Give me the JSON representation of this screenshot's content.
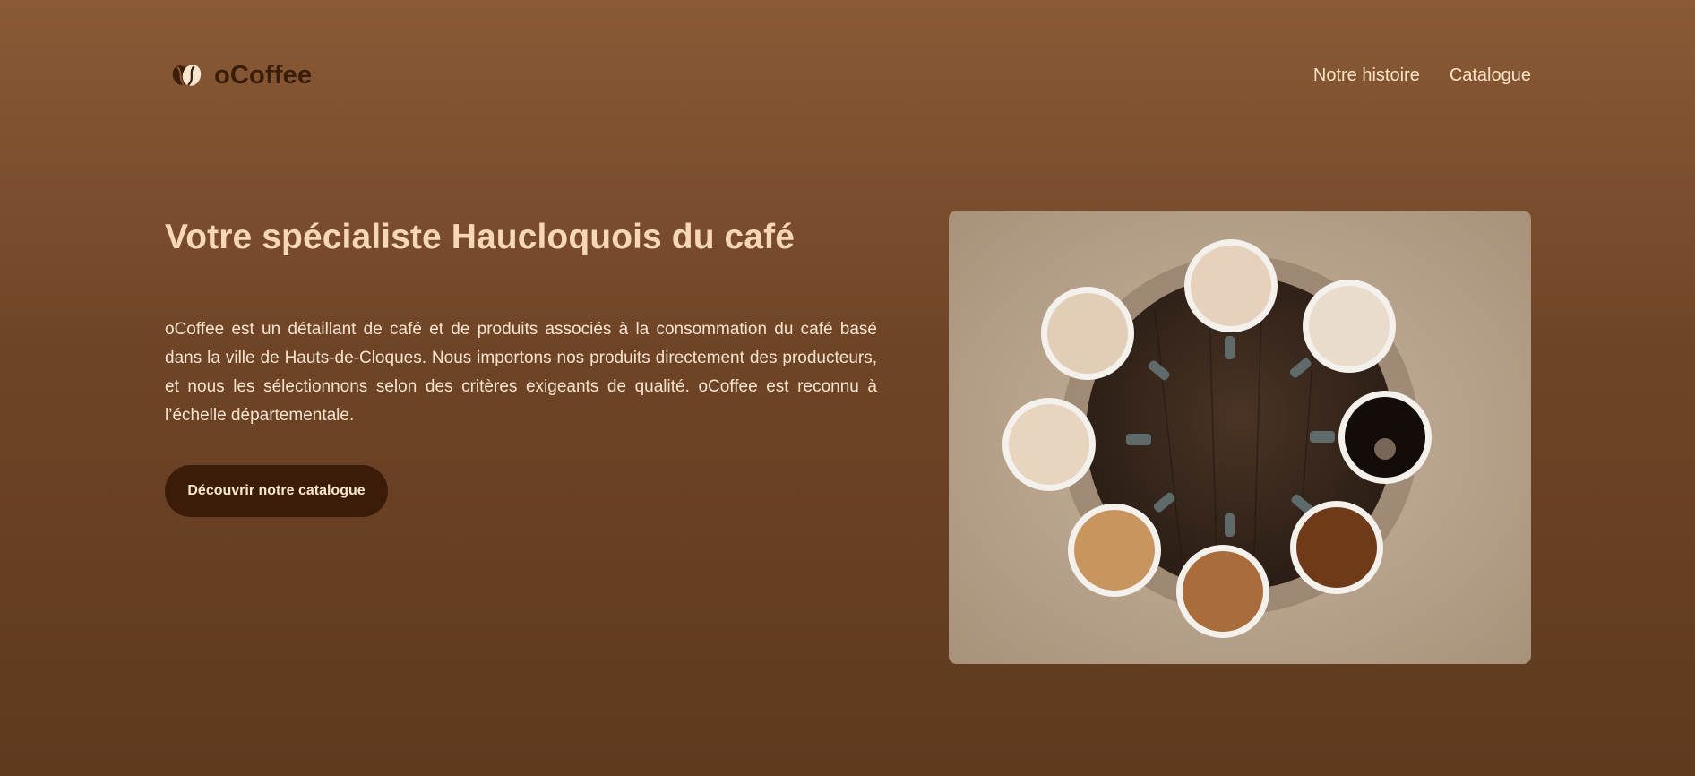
{
  "brand": {
    "name": "oCoffee",
    "logo_icon": "coffee-bean-icon",
    "color": "#3a1c08"
  },
  "nav": {
    "items": [
      {
        "label": "Notre histoire"
      },
      {
        "label": "Catalogue"
      }
    ]
  },
  "hero": {
    "title": "Votre spécialiste Haucloquois du café",
    "description": "oCoffee est un détaillant de café et de produits associés à la consommation du café basé dans la ville de Hauts-de-Cloques. Nous importons nos produits directement des producteurs, et nous les sélectionnons selon des critères exigeants de qualité. oCoffee est reconnu à l’échelle départementale.",
    "cta_label": "Découvrir notre catalogue",
    "image_icon": "coffee-cups-photo"
  },
  "colors": {
    "background_top": "#8a5a36",
    "background_bottom": "#5e3a1f",
    "title": "#f8d8b4",
    "button": "#3a1c08"
  }
}
